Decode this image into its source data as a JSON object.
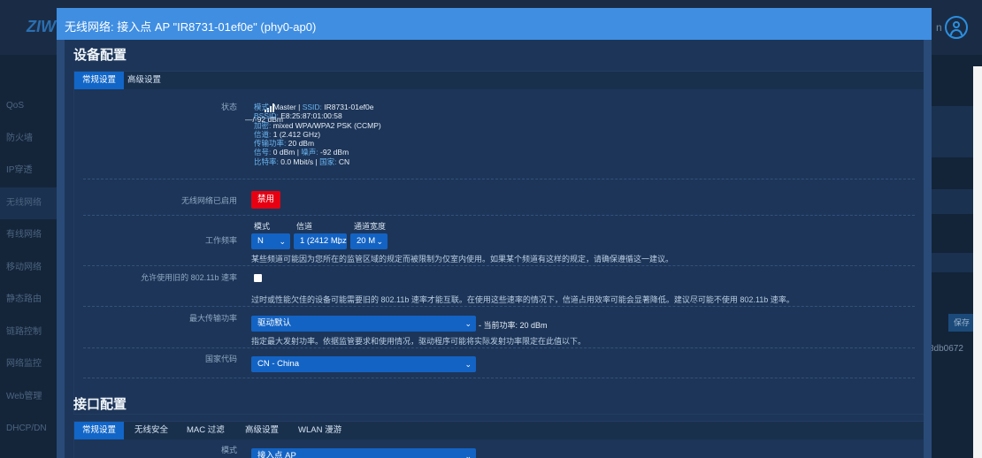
{
  "background": {
    "logo": "ZIW",
    "user_text": "n",
    "sidebar_items": [
      "QoS",
      "防火墙",
      "IP穿透",
      "无线网络",
      "有线网络",
      "移动网络",
      "静态路由",
      "链路控制",
      "网络监控",
      "Web管理",
      "DHCP/DN"
    ],
    "save_label": "保存",
    "hash_text": "8db0672"
  },
  "modal": {
    "title": "无线网络: 接入点 AP \"IR8731-01ef0e\" (phy0-ap0)"
  },
  "device_config": {
    "title": "设备配置",
    "tabs": [
      "常规设置",
      "高级设置"
    ],
    "status": {
      "label": "状态",
      "signal_text": "—/-92 dBm",
      "mode_key": "模式:",
      "mode_val": "Master",
      "ssid_key": "SSID:",
      "ssid_val": "IR8731-01ef0e",
      "bssid_key": "BSSID:",
      "bssid_val": "E8:25:87:01:00:58",
      "enc_key": "加密:",
      "enc_val": "mixed WPA/WPA2 PSK (CCMP)",
      "channel_key": "信道:",
      "channel_val": "1 (2.412 GHz)",
      "txpower_key": "传输功率:",
      "txpower_val": "20 dBm",
      "signal_key": "信号:",
      "signal_val": "0 dBm",
      "noise_key": "噪声:",
      "noise_val": "-92 dBm",
      "bitrate_key": "比特率:",
      "bitrate_val": "0.0 Mbit/s",
      "country_key": "国家:",
      "country_val": "CN"
    },
    "wireless_enabled": {
      "label": "无线网络已启用",
      "button": "禁用"
    },
    "frequency": {
      "label": "工作频率",
      "mode_header": "模式",
      "channel_header": "信道",
      "width_header": "通道宽度",
      "mode_value": "N",
      "channel_value": "1 (2412 Mhz",
      "width_value": "20 M",
      "note": "某些频道可能因为您所在的监管区域的规定而被限制为仅室内使用。如果某个频道有这样的规定，请确保遵循这一建议。"
    },
    "legacy_rates": {
      "label": "允许使用旧的 802.11b 速率",
      "checked": false,
      "note": "过时或性能欠佳的设备可能需要旧的 802.11b 速率才能互联。在使用这些速率的情况下，信道占用效率可能会显著降低。建议尽可能不使用 802.11b 速率。"
    },
    "tx_power": {
      "label": "最大传输功率",
      "value": "驱动默认",
      "current": "- 当前功率: 20 dBm",
      "note": "指定最大发射功率。依据监管要求和使用情况，驱动程序可能将实际发射功率限定在此值以下。"
    },
    "country": {
      "label": "国家代码",
      "value": "CN - China"
    }
  },
  "interface_config": {
    "title": "接口配置",
    "tabs": [
      "常规设置",
      "无线安全",
      "MAC 过滤",
      "高级设置",
      "WLAN 漫游"
    ],
    "mode": {
      "label": "模式",
      "value": "接入点 AP"
    }
  },
  "colors": {
    "modal_header": "#3f8ee2",
    "accent": "#1166c8",
    "danger": "#e60012",
    "info_key": "#69b4f0"
  }
}
